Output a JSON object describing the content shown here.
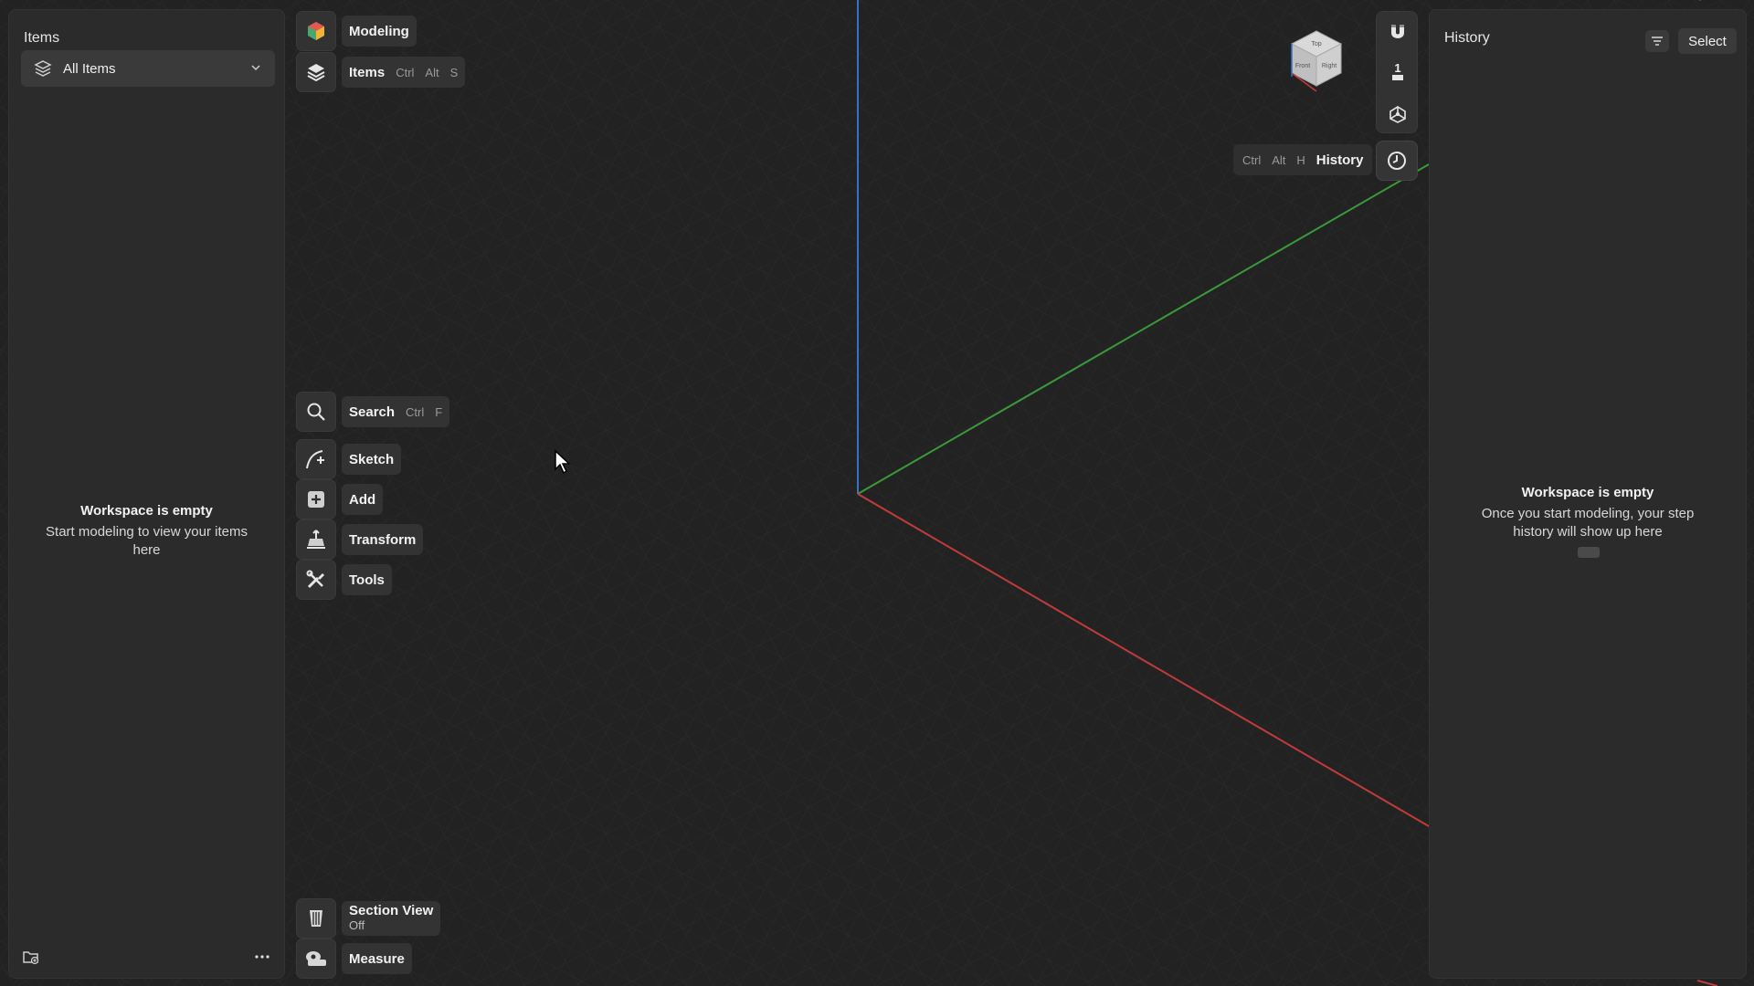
{
  "items_panel": {
    "title": "Items",
    "filter_label": "All Items",
    "empty_title": "Workspace is empty",
    "empty_desc": "Start modeling to view your items here"
  },
  "history_panel": {
    "title": "History",
    "select_label": "Select",
    "empty_title": "Workspace is empty",
    "empty_desc": "Once you start modeling, your step history will show up here"
  },
  "toolbar": {
    "modeling": "Modeling",
    "items": "Items",
    "items_keys": [
      "Ctrl",
      "Alt",
      "S"
    ],
    "search": "Search",
    "search_keys": [
      "Ctrl",
      "F"
    ],
    "sketch": "Sketch",
    "add": "Add",
    "transform": "Transform",
    "tools": "Tools",
    "section_view": "Section View",
    "section_view_state": "Off",
    "measure": "Measure"
  },
  "view_tools": {
    "scale_value": "1",
    "history_label": "History",
    "history_keys": [
      "Ctrl",
      "Alt",
      "H"
    ]
  },
  "view_cube": {
    "face_front": "Front",
    "face_right": "Right",
    "face_top": "Top"
  },
  "colors": {
    "axis_x": "#c23b3b",
    "axis_y": "#3a9a3a",
    "axis_z": "#3b6fc8",
    "panel_bg": "#2b2b2b",
    "viewport_bg": "#222222"
  },
  "icons": {
    "modeling": "cube-logo-icon",
    "items": "layers-icon",
    "search": "search-icon",
    "sketch": "sketch-icon",
    "add": "add-shape-icon",
    "transform": "transform-icon",
    "tools": "tools-icon",
    "section_view": "section-view-icon",
    "measure": "measure-icon",
    "magnet": "magnet-icon",
    "scale": "scale-icon",
    "orient": "orientation-icon",
    "history": "clock-icon"
  }
}
